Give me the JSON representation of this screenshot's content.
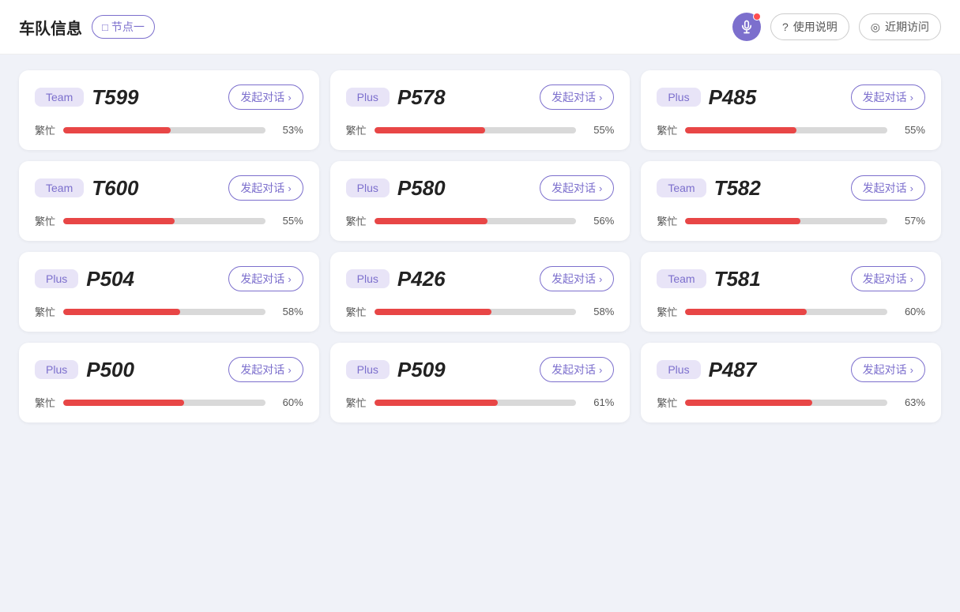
{
  "header": {
    "title": "车队信息",
    "node_label": "节点一",
    "node_icon": "□",
    "help_label": "使用说明",
    "recent_label": "近期访问",
    "help_icon": "?",
    "recent_icon": "◎"
  },
  "cards": [
    {
      "badge": "Team",
      "badge_type": "team",
      "id": "T599",
      "talk": "发起对话",
      "busy_label": "繁忙",
      "pct": 53
    },
    {
      "badge": "Plus",
      "badge_type": "plus",
      "id": "P578",
      "talk": "发起对话",
      "busy_label": "繁忙",
      "pct": 55
    },
    {
      "badge": "Plus",
      "badge_type": "plus",
      "id": "P485",
      "talk": "发起对话",
      "busy_label": "繁忙",
      "pct": 55
    },
    {
      "badge": "Team",
      "badge_type": "team",
      "id": "T600",
      "talk": "发起对话",
      "busy_label": "繁忙",
      "pct": 55
    },
    {
      "badge": "Plus",
      "badge_type": "plus",
      "id": "P580",
      "talk": "发起对话",
      "busy_label": "繁忙",
      "pct": 56
    },
    {
      "badge": "Team",
      "badge_type": "team",
      "id": "T582",
      "talk": "发起对话",
      "busy_label": "繁忙",
      "pct": 57
    },
    {
      "badge": "Plus",
      "badge_type": "plus",
      "id": "P504",
      "talk": "发起对话",
      "busy_label": "繁忙",
      "pct": 58
    },
    {
      "badge": "Plus",
      "badge_type": "plus",
      "id": "P426",
      "talk": "发起对话",
      "busy_label": "繁忙",
      "pct": 58
    },
    {
      "badge": "Team",
      "badge_type": "team",
      "id": "T581",
      "talk": "发起对话",
      "busy_label": "繁忙",
      "pct": 60
    },
    {
      "badge": "Plus",
      "badge_type": "plus",
      "id": "P500",
      "talk": "发起对话",
      "busy_label": "繁忙",
      "pct": 60
    },
    {
      "badge": "Plus",
      "badge_type": "plus",
      "id": "P509",
      "talk": "发起对话",
      "busy_label": "繁忙",
      "pct": 61
    },
    {
      "badge": "Plus",
      "badge_type": "plus",
      "id": "P487",
      "talk": "发起对话",
      "busy_label": "繁忙",
      "pct": 63
    }
  ]
}
